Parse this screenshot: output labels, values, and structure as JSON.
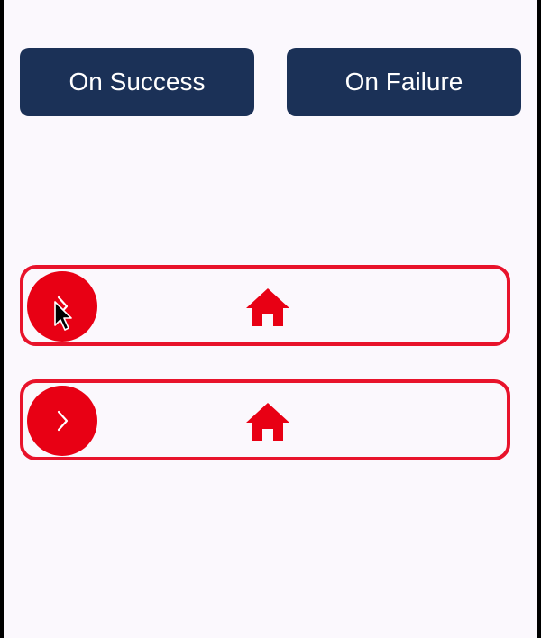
{
  "buttons": {
    "success_label": "On Success",
    "failure_label": "On Failure"
  },
  "sliders": [
    {
      "thumb_icon": "chevron-right-icon",
      "track_icon": "home-icon",
      "accent_color": "#e80014"
    },
    {
      "thumb_icon": "chevron-right-icon",
      "track_icon": "home-icon",
      "accent_color": "#e80014"
    }
  ],
  "colors": {
    "button_bg": "#1b3157",
    "button_text": "#ffffff",
    "accent": "#e80014",
    "screen_bg": "#fbf8fd"
  }
}
